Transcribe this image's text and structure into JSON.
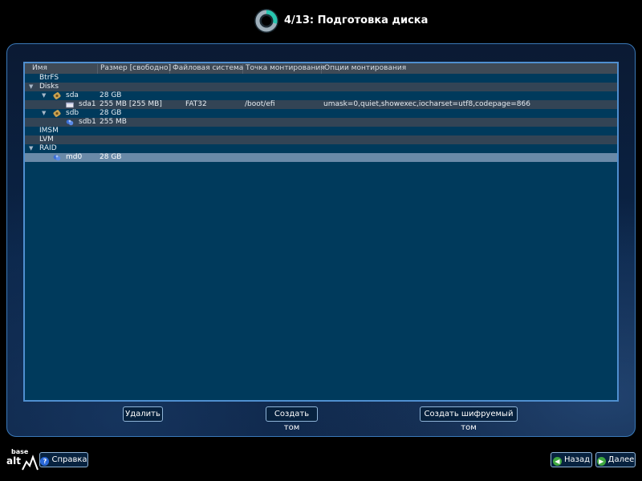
{
  "header": {
    "title": "4/13: Подготовка диска",
    "logo_icon": "progress-ring-icon"
  },
  "table": {
    "columns": [
      "Имя",
      "Размер [свободно]",
      "Файловая система",
      "Точка монтирования",
      "Опции монтирования"
    ],
    "rows": [
      {
        "name": "BtrFS",
        "size": "",
        "fs": "",
        "mount": "",
        "options": ""
      },
      {
        "name": "Disks",
        "size": "",
        "fs": "",
        "mount": "",
        "options": ""
      },
      {
        "name": "sda",
        "size": "28 GB",
        "fs": "",
        "mount": "",
        "options": ""
      },
      {
        "name": "sda1",
        "size": "255 MB [255 MB]",
        "fs": "FAT32",
        "mount": "/boot/efi",
        "options": "umask=0,quiet,showexec,iocharset=utf8,codepage=866"
      },
      {
        "name": "sdb",
        "size": "28 GB",
        "fs": "",
        "mount": "",
        "options": ""
      },
      {
        "name": "sdb1",
        "size": "255 MB",
        "fs": "",
        "mount": "",
        "options": ""
      },
      {
        "name": "IMSM",
        "size": "",
        "fs": "",
        "mount": "",
        "options": ""
      },
      {
        "name": "LVM",
        "size": "",
        "fs": "",
        "mount": "",
        "options": ""
      },
      {
        "name": "RAID",
        "size": "",
        "fs": "",
        "mount": "",
        "options": ""
      },
      {
        "name": "md0",
        "size": "28 GB",
        "fs": "",
        "mount": "",
        "options": ""
      }
    ]
  },
  "actions": {
    "delete": "Удалить",
    "create_volume": "Создать том",
    "create_encrypted": "Создать шифруемый том"
  },
  "footer": {
    "brand_top": "base",
    "brand_bottom": "alt",
    "help": "Справка",
    "back": "Назад",
    "next": "Далее"
  },
  "colors": {
    "panel": "#003a5c",
    "selection": "#6a8aa8",
    "border": "#4f8fd0",
    "accent": "#2ec4b6"
  }
}
